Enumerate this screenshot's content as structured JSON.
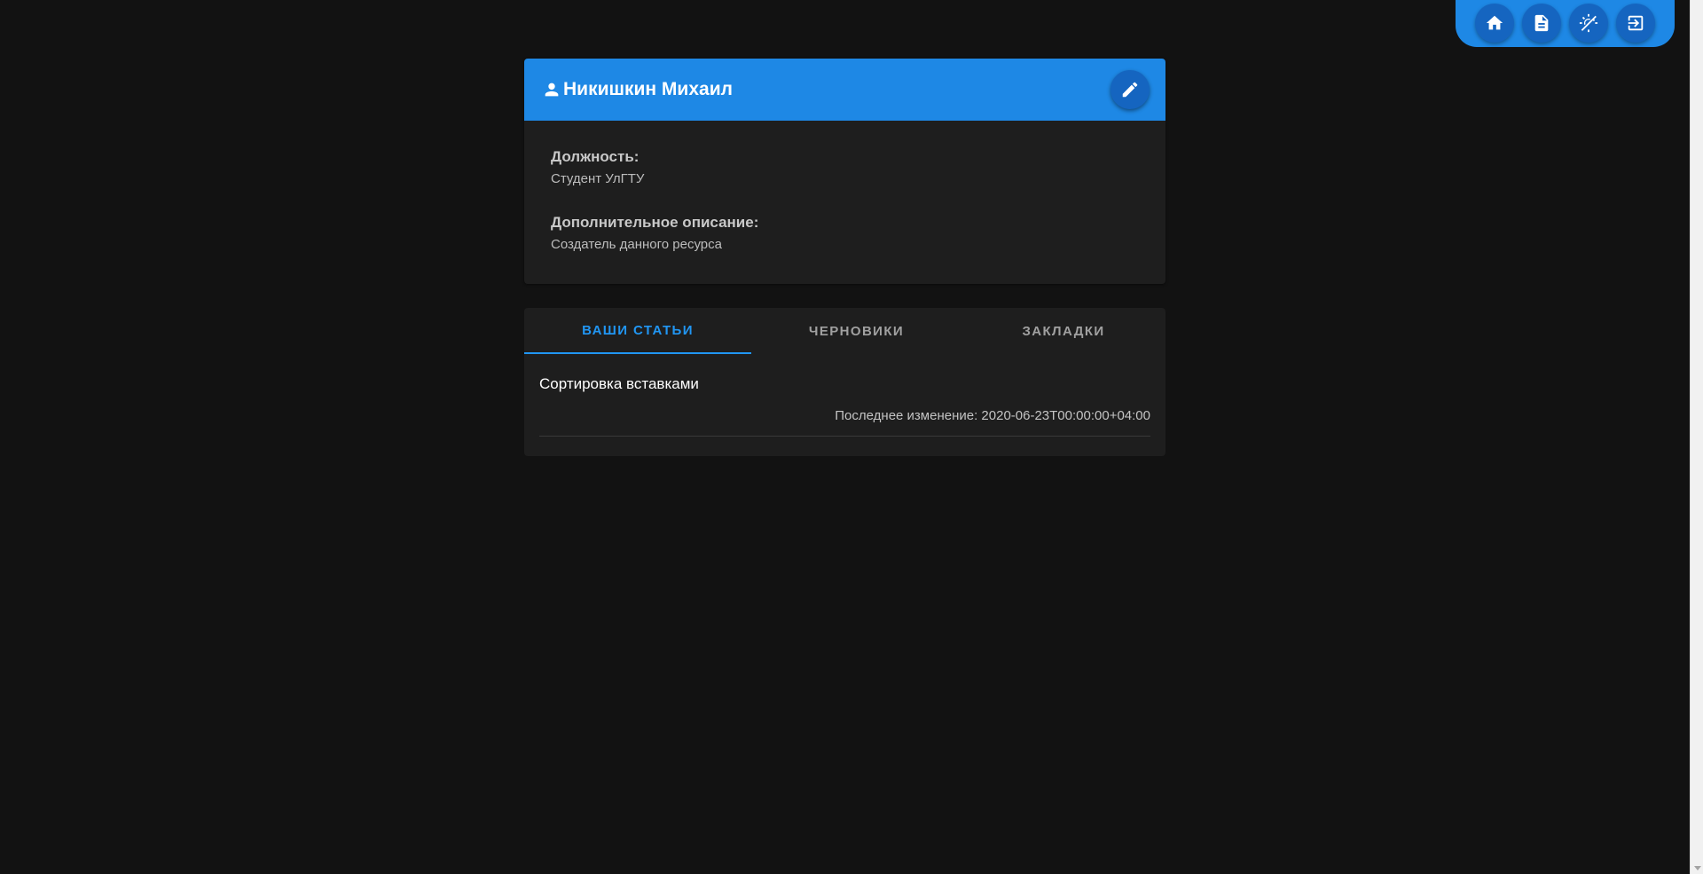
{
  "toolbar": {
    "buttons": [
      {
        "icon": "home-icon"
      },
      {
        "icon": "document-icon"
      },
      {
        "icon": "theme-toggle-icon"
      },
      {
        "icon": "logout-icon"
      }
    ],
    "color": "#1e88e5"
  },
  "profile": {
    "name": "Никишкин Михаил",
    "fields": [
      {
        "label": "Должность:",
        "value": "Студент УлГТУ"
      },
      {
        "label": "Дополнительное описание:",
        "value": "Создатель данного ресурса"
      }
    ]
  },
  "tabs": [
    {
      "label": "ВАШИ СТАТЬИ",
      "active": true
    },
    {
      "label": "ЧЕРНОВИКИ",
      "active": false
    },
    {
      "label": "ЗАКЛАДКИ",
      "active": false
    }
  ],
  "articles": [
    {
      "title": "Сортировка вставками",
      "meta": "Последнее изменение: 2020-06-23T00:00:00+04:00"
    }
  ],
  "colors": {
    "accent": "#1e88e5",
    "accent_dark": "#1565c0",
    "background": "#121212",
    "card": "#1e1e1e",
    "tab_active": "#2196f3"
  }
}
